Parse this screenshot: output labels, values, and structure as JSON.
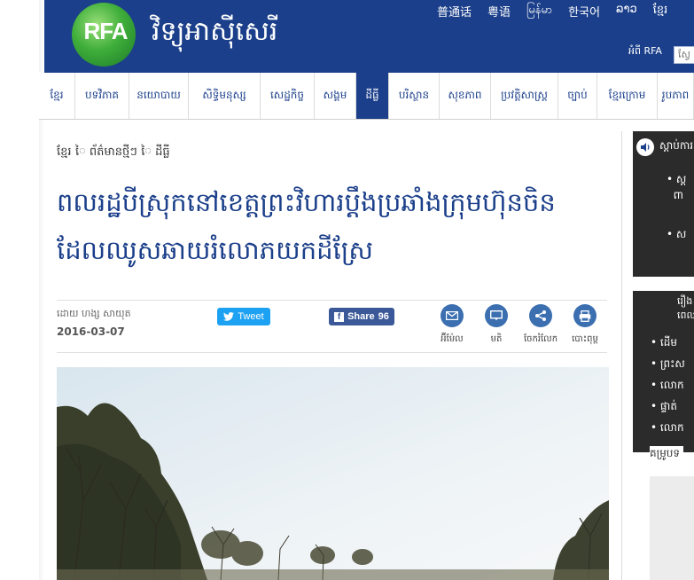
{
  "header": {
    "logo": "RFA",
    "site_title": "វិទ្យុអាស៊ីសេរី",
    "languages": [
      "普通话",
      "粤语",
      "မြန်မာ",
      "한국어",
      "ລາວ",
      "ខ្មែរ"
    ],
    "about": "អំពី RFA",
    "search_placeholder": "ស្វែ"
  },
  "nav": {
    "items": [
      "ខ្មែរ",
      "បទវិភាគ",
      "នយោបាយ",
      "សិទ្ធិមនុស្ស",
      "សេដ្ឋកិច្ច",
      "សង្គម",
      "ដីធ្លី",
      "បរិស្ថាន",
      "សុខភាព",
      "ប្រវត្តិសាស្ត្រ",
      "ច្បាប់",
      "ខ្មែរក្រោម",
      "រូបភាព"
    ],
    "active_index": 6
  },
  "article": {
    "breadcrumb": "ខ្មែរ ៃ ព័ត៌មានថ្មីៗ ៃ ដីធ្លី",
    "headline": "ពលរដ្ឋបីស្រុកនៅខេត្តព្រះវិហារប្ដឹងប្រឆាំងក្រុមហ៊ុនចិនដែលឈូសឆាយរំលោភយកដីស្រែ",
    "byline": "ដោយ ហង្ស សាយុត",
    "date": "2016-03-07",
    "tweet_label": "Tweet",
    "share_label": "Share",
    "share_count": "96",
    "tools": [
      "អ៊ីម៉ែល",
      "មតិ",
      "ចែករំលែក",
      "បោះពុម្ព"
    ]
  },
  "sidebar": {
    "listen_title": "ស្ដាប់ការ",
    "listen_items": [
      "ស្ត",
      "ស"
    ],
    "listen_subs": [
      "ពា"
    ],
    "news_head_line1": "រឿង",
    "news_head_line2": "ពេល",
    "news_items": [
      "ដើម",
      "ព្រះស",
      "លោក",
      "ផ្ទាត់",
      "លោក"
    ],
    "more_label": "គម្រូបទ"
  },
  "colors": {
    "header_bg": "#1b3f8a",
    "nav_active_bg": "#1b3f8a",
    "tweet": "#1da1f2",
    "facebook": "#3b5998",
    "sidebar_box": "#2b2b2b"
  }
}
